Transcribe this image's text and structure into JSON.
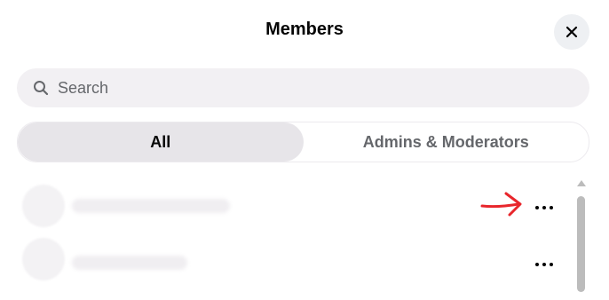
{
  "header": {
    "title": "Members",
    "close_icon": "close-icon"
  },
  "search": {
    "placeholder": "Search",
    "value": "",
    "icon": "search-icon"
  },
  "tabs": [
    {
      "label": "All",
      "active": true
    },
    {
      "label": "Admins & Moderators",
      "active": false
    }
  ],
  "members": [
    {
      "name_visible": false,
      "more_icon": "more-horizontal-icon"
    },
    {
      "name_visible": false,
      "more_icon": "more-horizontal-icon"
    }
  ],
  "annotation": {
    "icon": "red-arrow-icon",
    "color": "#e8262c"
  },
  "colors": {
    "text": "#050505",
    "muted": "#65676b",
    "search_bg": "#f2f0f3",
    "active_tab_bg": "#e7e5e9"
  }
}
